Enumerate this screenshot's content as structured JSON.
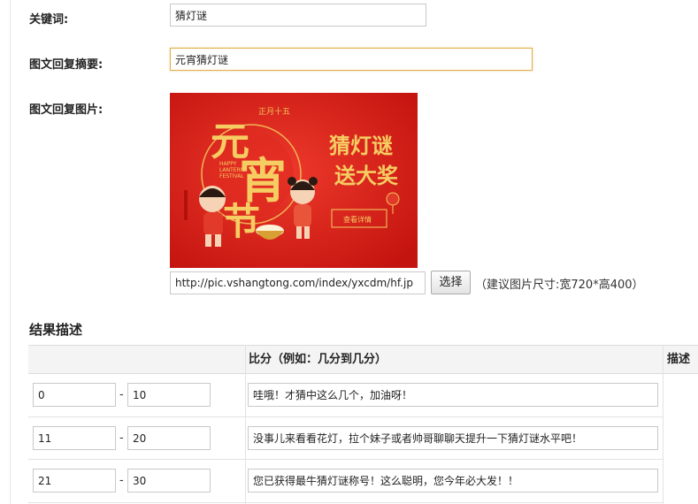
{
  "form": {
    "keyword_label": "关键词:",
    "keyword_value": "猜灯谜",
    "summary_label": "图文回复摘要:",
    "summary_value": "元宵猜灯谜",
    "image_label": "图文回复图片:",
    "image": {
      "lunar_date": "正月十五",
      "headline_chars": [
        "元",
        "宵",
        "节"
      ],
      "en_line1": "HAPPY",
      "en_line2": "LANTERN",
      "en_line3": "FESTIVAL",
      "promo_line1": "猜灯谜",
      "promo_line2": "送大奖",
      "detail_button": "查看详情"
    },
    "image_url": "http://pic.vshangtong.com/index/yxcdm/hf.jp",
    "select_button": "选择",
    "size_hint": "（建议图片尺寸:宽720*高400）"
  },
  "results": {
    "title": "结果描述",
    "columns": [
      "",
      "比分（例如：几分到几分）",
      "描述"
    ],
    "separator": "-",
    "rows": [
      {
        "from": "0",
        "to": "10",
        "desc": "哇哦！才猜中这么几个，加油呀！"
      },
      {
        "from": "11",
        "to": "20",
        "desc": "没事儿来看看花灯，拉个妹子或者帅哥聊聊天提升一下猜灯谜水平吧！"
      },
      {
        "from": "21",
        "to": "30",
        "desc": "您已获得最牛猜灯谜称号！这么聪明，您今年必大发！！"
      }
    ]
  },
  "colors": {
    "poster_red": "#d61f1c",
    "gold": "#f2c45a",
    "focus_border": "#e0b04a"
  }
}
